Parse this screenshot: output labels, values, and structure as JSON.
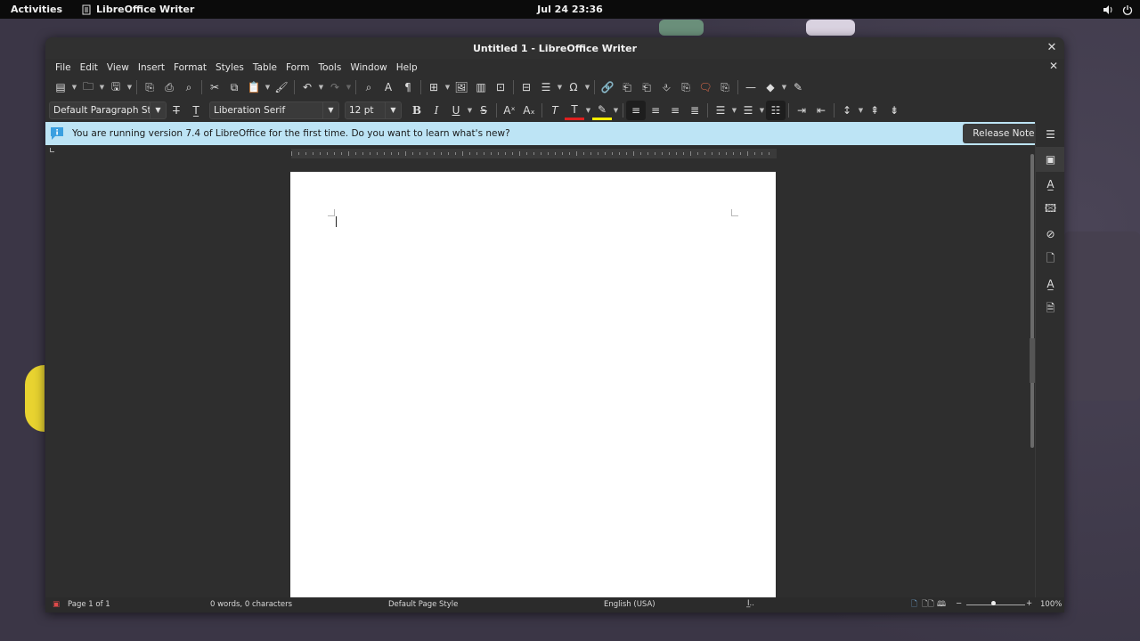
{
  "topbar": {
    "activities": "Activities",
    "app_name": "LibreOffice Writer",
    "clock": "Jul 24  23:36"
  },
  "window": {
    "title": "Untitled 1 - LibreOffice Writer"
  },
  "menu": [
    "File",
    "Edit",
    "View",
    "Insert",
    "Format",
    "Styles",
    "Table",
    "Form",
    "Tools",
    "Window",
    "Help"
  ],
  "format_bar": {
    "paragraph_style": "Default Paragraph Style",
    "font_name": "Liberation Serif",
    "font_size": "12 pt"
  },
  "infobar": {
    "message": "You are running version 7.4 of LibreOffice for the first time. Do you want to learn what's new?",
    "button": "Release Notes"
  },
  "statusbar": {
    "page": "Page 1 of 1",
    "words": "0 words, 0 characters",
    "page_style": "Default Page Style",
    "language": "English (USA)",
    "zoom": "100%"
  },
  "colors": {
    "infobar_bg": "#bde4f5",
    "font_color_swatch": "#e02020",
    "highlight_swatch": "#ffee00"
  }
}
